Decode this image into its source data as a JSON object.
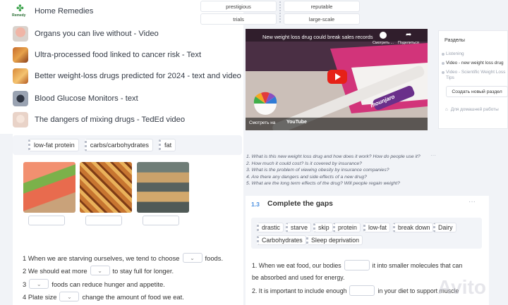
{
  "lesson_list": {
    "logo_text": "Remedy",
    "items": [
      {
        "label": "Home Remedies"
      },
      {
        "label": "Organs you can live without - Video"
      },
      {
        "label": "Ultra-processed food linked to cancer risk - Text"
      },
      {
        "label": "Better weight-loss drugs predicted for 2024 - text and video"
      },
      {
        "label": "Blood Glucose Monitors - text"
      },
      {
        "label": "The dangers of mixing drugs - TedEd video"
      }
    ]
  },
  "top_words": {
    "row1": [
      "prestigious",
      "reputable"
    ],
    "row2": [
      "trials",
      "large-scale"
    ]
  },
  "vocab": {
    "chips": [
      "low-fat protein",
      "carbs/carbohydrates",
      "fat"
    ],
    "sentences": [
      {
        "before": "1 When we are starving ourselves, we tend to choose",
        "after": "foods."
      },
      {
        "before": "2 We should eat more",
        "after": "to stay full for longer."
      },
      {
        "before": "3",
        "after": "foods can reduce hunger and appetite."
      },
      {
        "before": "4 Plate size",
        "after": "change the amount of food we eat."
      }
    ],
    "select_glyph": "⌄"
  },
  "video": {
    "title": "New weight loss drug could break sales records",
    "watch_later": "Смотреть ...",
    "share": "Поделиться",
    "watch_on": "Смотреть на",
    "platform": "YouTube",
    "brand": "mounjaro"
  },
  "questions": [
    "1. What is this new weight loss drug and how does it work? How do people use it?",
    "2. How much it could cost? Is it covered by insurance?",
    "3. What is the problem of viewing obesity by insurance companies?",
    "4. Are there any dangers and side effects of a new drug?",
    "5. What are the long term effects of the drug? Will people regain weight?"
  ],
  "exercise": {
    "number": "1.3",
    "title": "Complete the gaps",
    "more": "···",
    "chips_row1": [
      "drastic",
      "starve",
      "skip",
      "protein",
      "low-fat",
      "break down",
      "Dairy"
    ],
    "chips_row2": [
      "Carbohydrates",
      "Sleep deprivation"
    ],
    "line1_before": "1. When we eat food, our bodies",
    "line1_after": "it into smaller molecules that can",
    "line1_cont": "be absorbed and used for energy.",
    "line2_before": "2. It is important to include enough",
    "line2_after": "in your diet to support muscle"
  },
  "sidebar": {
    "title": "Разделы",
    "items": [
      {
        "label": "Listening"
      },
      {
        "label": "Video - new weight loss drug"
      },
      {
        "label": "Video - Scientific Weight Loss"
      },
      {
        "label": "Tips"
      }
    ],
    "create_button": "Создать новый раздел",
    "home_hint": "Для домашней работы"
  },
  "watermark": "Avito"
}
